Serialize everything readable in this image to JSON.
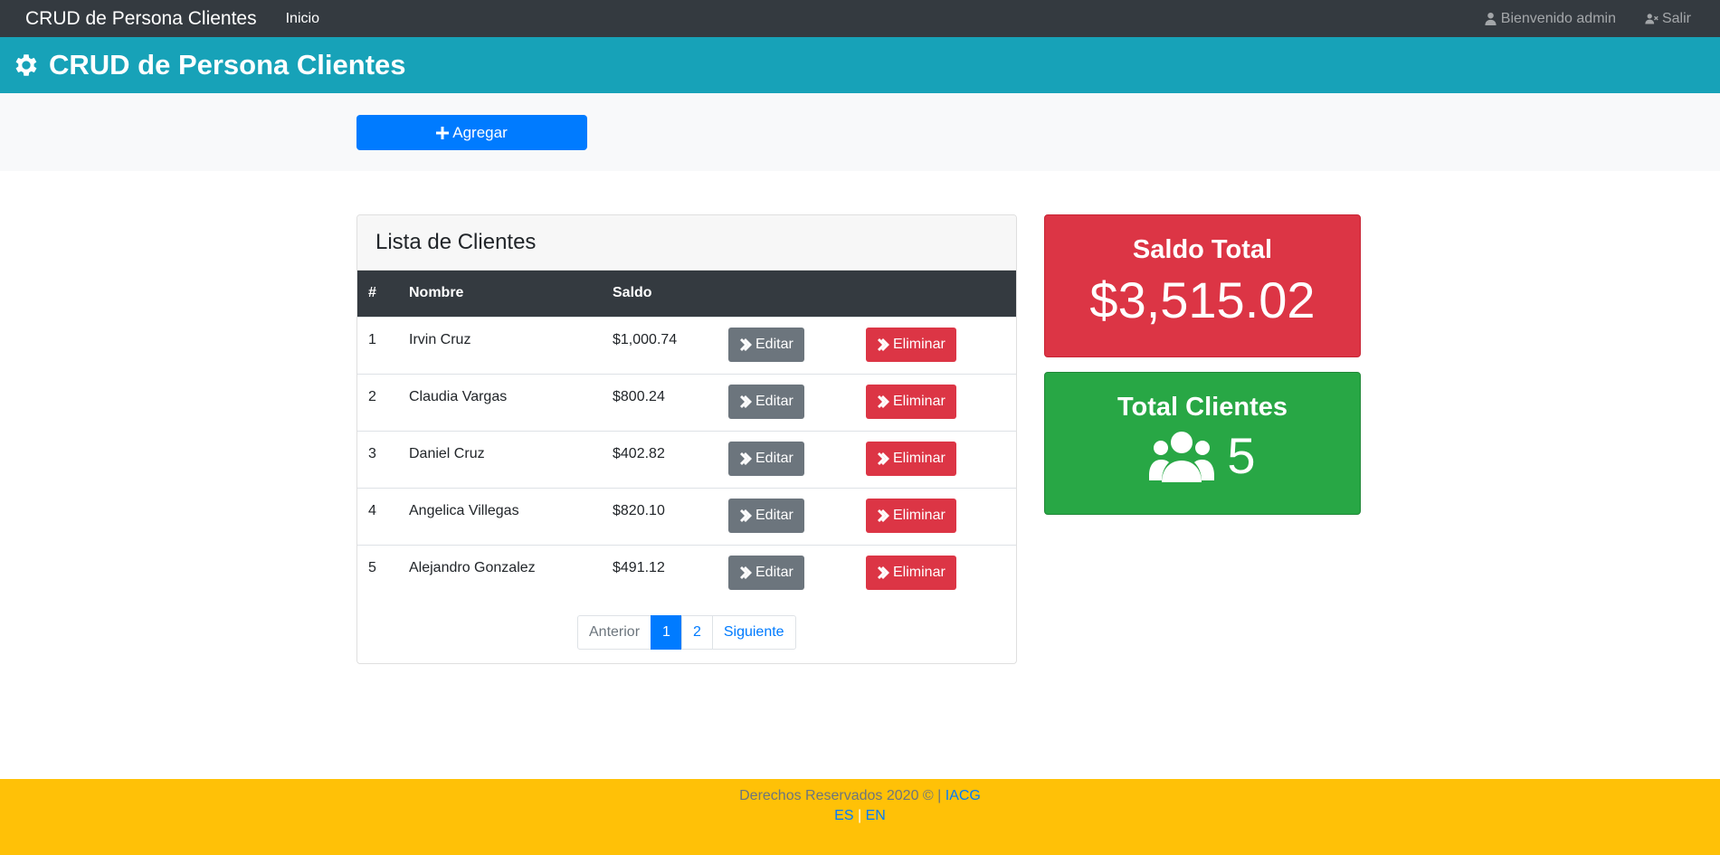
{
  "navbar": {
    "brand": "CRUD de Persona Clientes",
    "home": "Inicio",
    "welcome": "Bienvenido admin",
    "logout": "Salir"
  },
  "header": {
    "title": "CRUD de Persona Clientes"
  },
  "actions": {
    "add_label": "Agregar"
  },
  "list": {
    "title": "Lista de Clientes",
    "columns": [
      "#",
      "Nombre",
      "Saldo"
    ],
    "edit_label": "Editar",
    "delete_label": "Eliminar",
    "rows": [
      {
        "num": "1",
        "name": "Irvin Cruz",
        "saldo": "$1,000.74"
      },
      {
        "num": "2",
        "name": "Claudia Vargas",
        "saldo": "$800.24"
      },
      {
        "num": "3",
        "name": "Daniel Cruz",
        "saldo": "$402.82"
      },
      {
        "num": "4",
        "name": "Angelica Villegas",
        "saldo": "$820.10"
      },
      {
        "num": "5",
        "name": "Alejandro Gonzalez",
        "saldo": "$491.12"
      }
    ],
    "pagination": {
      "prev": "Anterior",
      "pages": [
        "1",
        "2"
      ],
      "current": "1",
      "next": "Siguiente"
    }
  },
  "summary": {
    "saldo_title": "Saldo Total",
    "saldo_value": "$3,515.02",
    "clientes_title": "Total Clientes",
    "clientes_value": "5"
  },
  "footer": {
    "rights": "Derechos Reservados 2020 © |",
    "author": "IACG",
    "lang_es": "ES",
    "lang_sep": "|",
    "lang_en": "EN"
  },
  "colors": {
    "navbar": "#343a40",
    "header": "#17a2b8",
    "primary": "#007bff",
    "danger": "#dc3545",
    "success": "#28a745",
    "secondary": "#6c757d",
    "footer": "#ffc107"
  }
}
